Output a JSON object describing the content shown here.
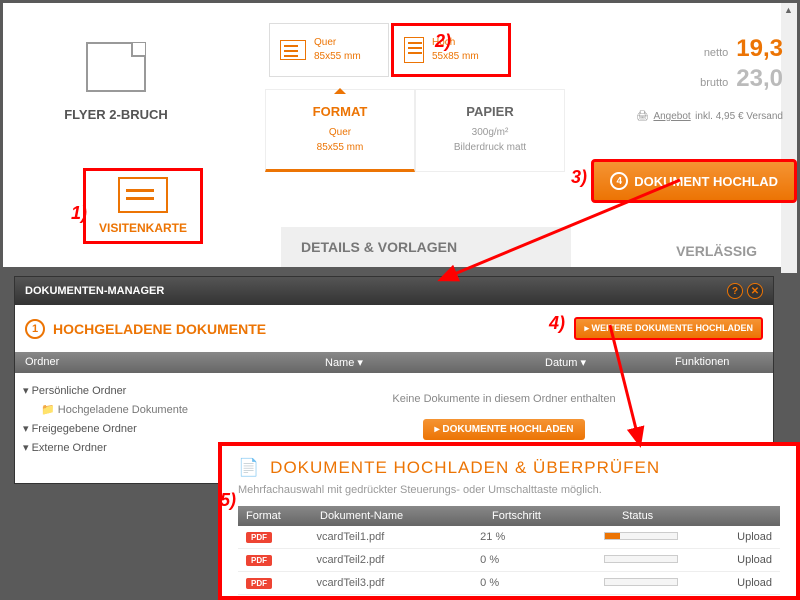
{
  "product": {
    "flyer_label": "FLYER 2-BRUCH",
    "visiten_label": "VISITENKARTE"
  },
  "options": {
    "quer": {
      "name": "Quer",
      "size": "85x55 mm"
    },
    "hoch": {
      "name": "Hoch",
      "size": "55x85 mm"
    },
    "format": {
      "title": "FORMAT",
      "line1": "Quer",
      "line2": "85x55 mm"
    },
    "papier": {
      "title": "PAPIER",
      "line1": "300g/m²",
      "line2": "Bilderdruck matt"
    }
  },
  "price": {
    "netto_label": "netto",
    "netto": "19,3",
    "brutto_label": "brutto",
    "brutto": "23,0",
    "angebot": "Angebot",
    "versand": "inkl. 4,95 € Versand"
  },
  "upload_btn": "DOKUMENT HOCHLAD",
  "details": "DETAILS & VORLAGEN",
  "verlassig": "VERLÄSSIG",
  "steps": {
    "s1": "1)",
    "s2": "2)",
    "s3": "3)",
    "s4": "4)",
    "s5": "5)"
  },
  "dm": {
    "header": "DOKUMENTEN-MANAGER",
    "title": "HOCHGELADENE DOKUMENTE",
    "more": "▸ WEITERE DOKUMENTE HOCHLADEN",
    "cols": {
      "ordner": "Ordner",
      "name": "Name ▾",
      "datum": "Datum ▾",
      "funk": "Funktionen"
    },
    "tree": {
      "pers": "▾ Persönliche Ordner",
      "hoch": "📁 Hochgeladene Dokumente",
      "frei": "▾ Freigegebene Ordner",
      "ext": "▾ Externe Ordner"
    },
    "empty": "Keine Dokumente in diesem Ordner enthalten",
    "empty_btn": "▸ DOKUMENTE HOCHLADEN"
  },
  "up": {
    "title": "DOKUMENTE HOCHLADEN & ÜBERPRÜFEN",
    "sub": "Mehrfachauswahl mit gedrückter Steuerungs- oder Umschalttaste möglich.",
    "cols": {
      "format": "Format",
      "name": "Dokument-Name",
      "fort": "Fortschritt",
      "status": "Status"
    },
    "rows": [
      {
        "fmt": "PDF",
        "name": "vcardTeil1.pdf",
        "pct": "21 %",
        "prog": 21,
        "act": "Upload"
      },
      {
        "fmt": "PDF",
        "name": "vcardTeil2.pdf",
        "pct": "0 %",
        "prog": 0,
        "act": "Upload"
      },
      {
        "fmt": "PDF",
        "name": "vcardTeil3.pdf",
        "pct": "0 %",
        "prog": 0,
        "act": "Upload"
      }
    ]
  }
}
